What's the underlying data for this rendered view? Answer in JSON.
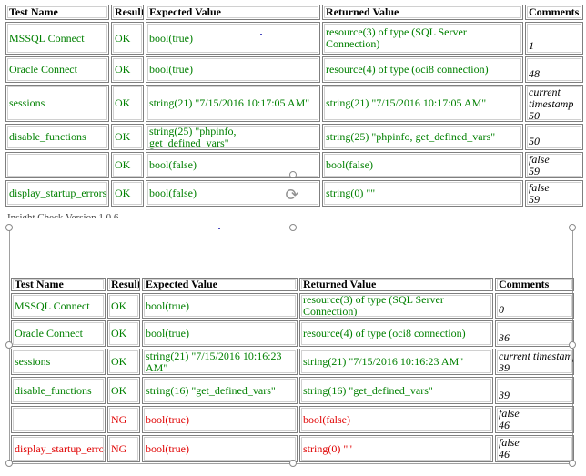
{
  "headers": [
    "Test Name",
    "Result",
    "Expected Value",
    "Returned Value",
    "Comments"
  ],
  "table1": {
    "rows": [
      {
        "name": "MSSQL Connect",
        "result": "OK",
        "status": "pass",
        "expected": "bool(true)",
        "returned": "resource(3) of type (SQL Server Connection)",
        "comments": [
          "1"
        ]
      },
      {
        "name": "Oracle Connect",
        "result": "OK",
        "status": "pass",
        "expected": "bool(true)",
        "returned": "resource(4) of type (oci8 connection)",
        "comments": [
          "48"
        ]
      },
      {
        "name": "sessions",
        "result": "OK",
        "status": "pass",
        "expected": "string(21) \"7/15/2016 10:17:05 AM\"",
        "returned": "string(21) \"7/15/2016 10:17:05 AM\"",
        "comments": [
          "current",
          "timestamp",
          "50"
        ]
      },
      {
        "name": "disable_functions",
        "result": "OK",
        "status": "pass",
        "expected": "string(25) \"phpinfo, get_defined_vars\"",
        "returned": "string(25) \"phpinfo, get_defined_vars\"",
        "comments": [
          "50"
        ]
      },
      {
        "name": "",
        "result": "OK",
        "status": "pass",
        "expected": "bool(false)",
        "returned": "bool(false)",
        "comments": [
          "false",
          "59"
        ]
      },
      {
        "name": "display_startup_errors",
        "result": "OK",
        "status": "pass",
        "expected": "bool(false)",
        "returned": "string(0) \"\"",
        "comments": [
          "false",
          "59"
        ]
      }
    ]
  },
  "separator_text": "Insight Check Version 1.0.6",
  "table2": {
    "rows": [
      {
        "name": "MSSQL Connect",
        "result": "OK",
        "status": "pass",
        "expected": "bool(true)",
        "returned": "resource(3) of type (SQL Server Connection)",
        "comments": [
          "0"
        ]
      },
      {
        "name": "Oracle Connect",
        "result": "OK",
        "status": "pass",
        "expected": "bool(true)",
        "returned": "resource(4) of type (oci8 connection)",
        "comments": [
          "36"
        ]
      },
      {
        "name": "sessions",
        "result": "OK",
        "status": "pass",
        "expected": "string(21) \"7/15/2016 10:16:23 AM\"",
        "returned": "string(21) \"7/15/2016 10:16:23 AM\"",
        "comments": [
          "current timestamp",
          "39"
        ]
      },
      {
        "name": "disable_functions",
        "result": "OK",
        "status": "pass",
        "expected": "string(16) \"get_defined_vars\"",
        "returned": "string(16) \"get_defined_vars\"",
        "comments": [
          "39"
        ]
      },
      {
        "name": "",
        "result": "NG",
        "status": "fail",
        "expected": "bool(true)",
        "returned": "bool(false)",
        "comments": [
          "false",
          "46"
        ]
      },
      {
        "name": "display_startup_errors",
        "result": "NG",
        "status": "fail",
        "expected": "bool(true)",
        "returned": "string(0) \"\"",
        "comments": [
          "false",
          "46"
        ]
      }
    ]
  },
  "colors": {
    "pass": "#008000",
    "fail": "#e00000",
    "border": "#7f7f7f"
  },
  "icons": {
    "rotate_handle": "rotate-icon",
    "resize_handle": "resize-handle"
  }
}
